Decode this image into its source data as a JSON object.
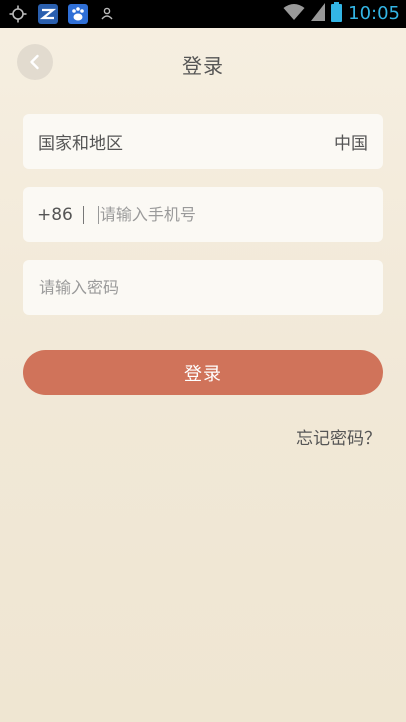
{
  "status_bar": {
    "time": "10:05",
    "icons": [
      "gps-icon",
      "app-icon",
      "baidu-icon",
      "user-icon",
      "wifi-icon",
      "signal-icon",
      "battery-icon"
    ]
  },
  "header": {
    "title": "登录",
    "back_icon": "chevron-left-icon"
  },
  "form": {
    "region": {
      "label": "国家和地区",
      "value": "中国"
    },
    "phone": {
      "country_code": "+86",
      "placeholder": "请输入手机号",
      "value": ""
    },
    "password": {
      "placeholder": "请输入密码",
      "value": ""
    }
  },
  "login_button": {
    "label": "登录"
  },
  "forgot_password": {
    "label": "忘记密码？"
  },
  "colors": {
    "accent": "#d0735a",
    "background": "#f3ebdc",
    "field_background": "#fbf9f4",
    "status_icon": "#33b5e5"
  }
}
